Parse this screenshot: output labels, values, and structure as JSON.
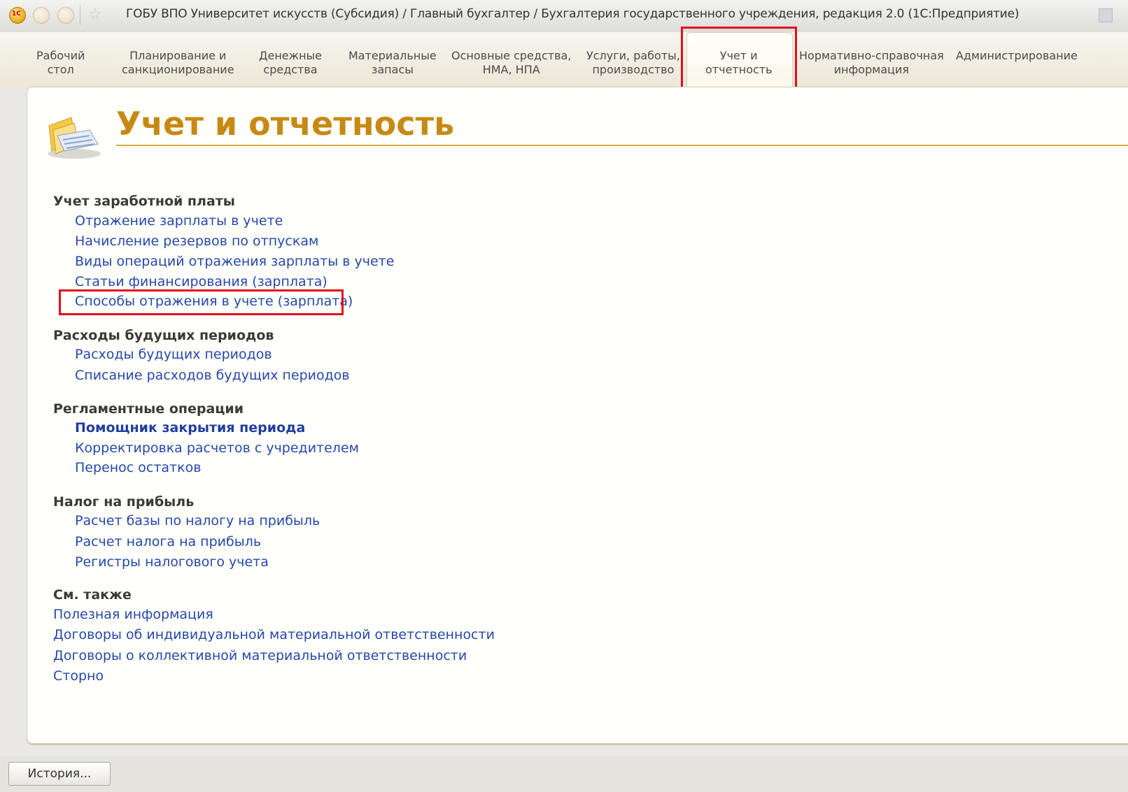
{
  "window": {
    "title": "ГОБУ ВПО Университет искусств (Субсидия) / Главный бухгалтер / Бухгалтерия государственного учреждения, редакция 2.0  (1С:Предприятие)",
    "logo_text": "1С"
  },
  "tabs": [
    {
      "line1": "Рабочий",
      "line2": "стол"
    },
    {
      "line1": "Планирование и",
      "line2": "санкционирование"
    },
    {
      "line1": "Денежные",
      "line2": "средства"
    },
    {
      "line1": "Материальные",
      "line2": "запасы"
    },
    {
      "line1": "Основные средства,",
      "line2": "НМА, НПА"
    },
    {
      "line1": "Услуги, работы,",
      "line2": "производство"
    },
    {
      "line1": "Учет и",
      "line2": "отчетность"
    },
    {
      "line1": "Нормативно-справочная",
      "line2": "информация"
    },
    {
      "line1": "Администрирование",
      "line2": ""
    }
  ],
  "page": {
    "title": "Учет и отчетность"
  },
  "groups": {
    "salary": {
      "title": "Учет заработной платы",
      "links": [
        "Отражение зарплаты в учете",
        "Начисление резервов по отпускам",
        "Виды операций отражения зарплаты в учете",
        "Статьи финансирования (зарплата)",
        "Способы отражения в учете (зарплата)"
      ]
    },
    "deferred": {
      "title": "Расходы будущих периодов",
      "links": [
        "Расходы будущих периодов",
        "Списание расходов будущих периодов"
      ]
    },
    "routine": {
      "title": "Регламентные операции",
      "links": [
        "Помощник закрытия периода",
        "Корректировка расчетов с учредителем",
        "Перенос остатков"
      ]
    },
    "tax": {
      "title": "Налог на прибыль",
      "links": [
        "Расчет базы по налогу на прибыль",
        "Расчет налога на прибыль",
        "Регистры налогового учета"
      ]
    },
    "see_also": {
      "title": "См. также",
      "links": [
        "Полезная информация",
        "Договоры об индивидуальной материальной ответственности",
        "Договоры о коллективной материальной ответственности",
        "Сторно"
      ]
    }
  },
  "bottom": {
    "history_label": "История..."
  },
  "colors": {
    "accent": "#c68a14",
    "link": "#2548a8",
    "highlight": "#e0101c"
  }
}
